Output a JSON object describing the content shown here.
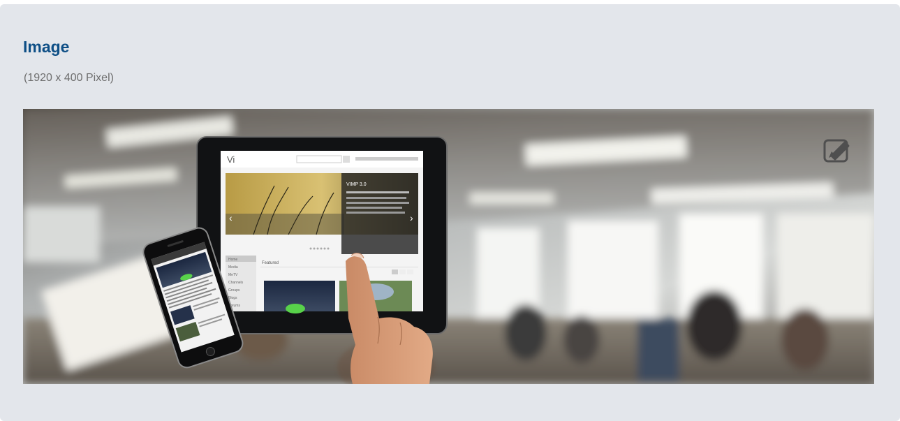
{
  "section": {
    "title": "Image",
    "dimensions_hint": "(1920 x 400 Pixel)"
  },
  "banner": {
    "edit_icon": "edit-pencil-icon"
  },
  "tablet_screen": {
    "slide_title": "VIMP 3.0",
    "featured_label": "Featured",
    "sidebar_items": [
      "Home",
      "Media",
      "MeTV",
      "Channels",
      "Groups",
      "Blogs",
      "Forums"
    ]
  },
  "colors": {
    "title": "#0e4f86",
    "subtitle": "#6e6e6e",
    "panel_bg": "#e3e6eb"
  }
}
